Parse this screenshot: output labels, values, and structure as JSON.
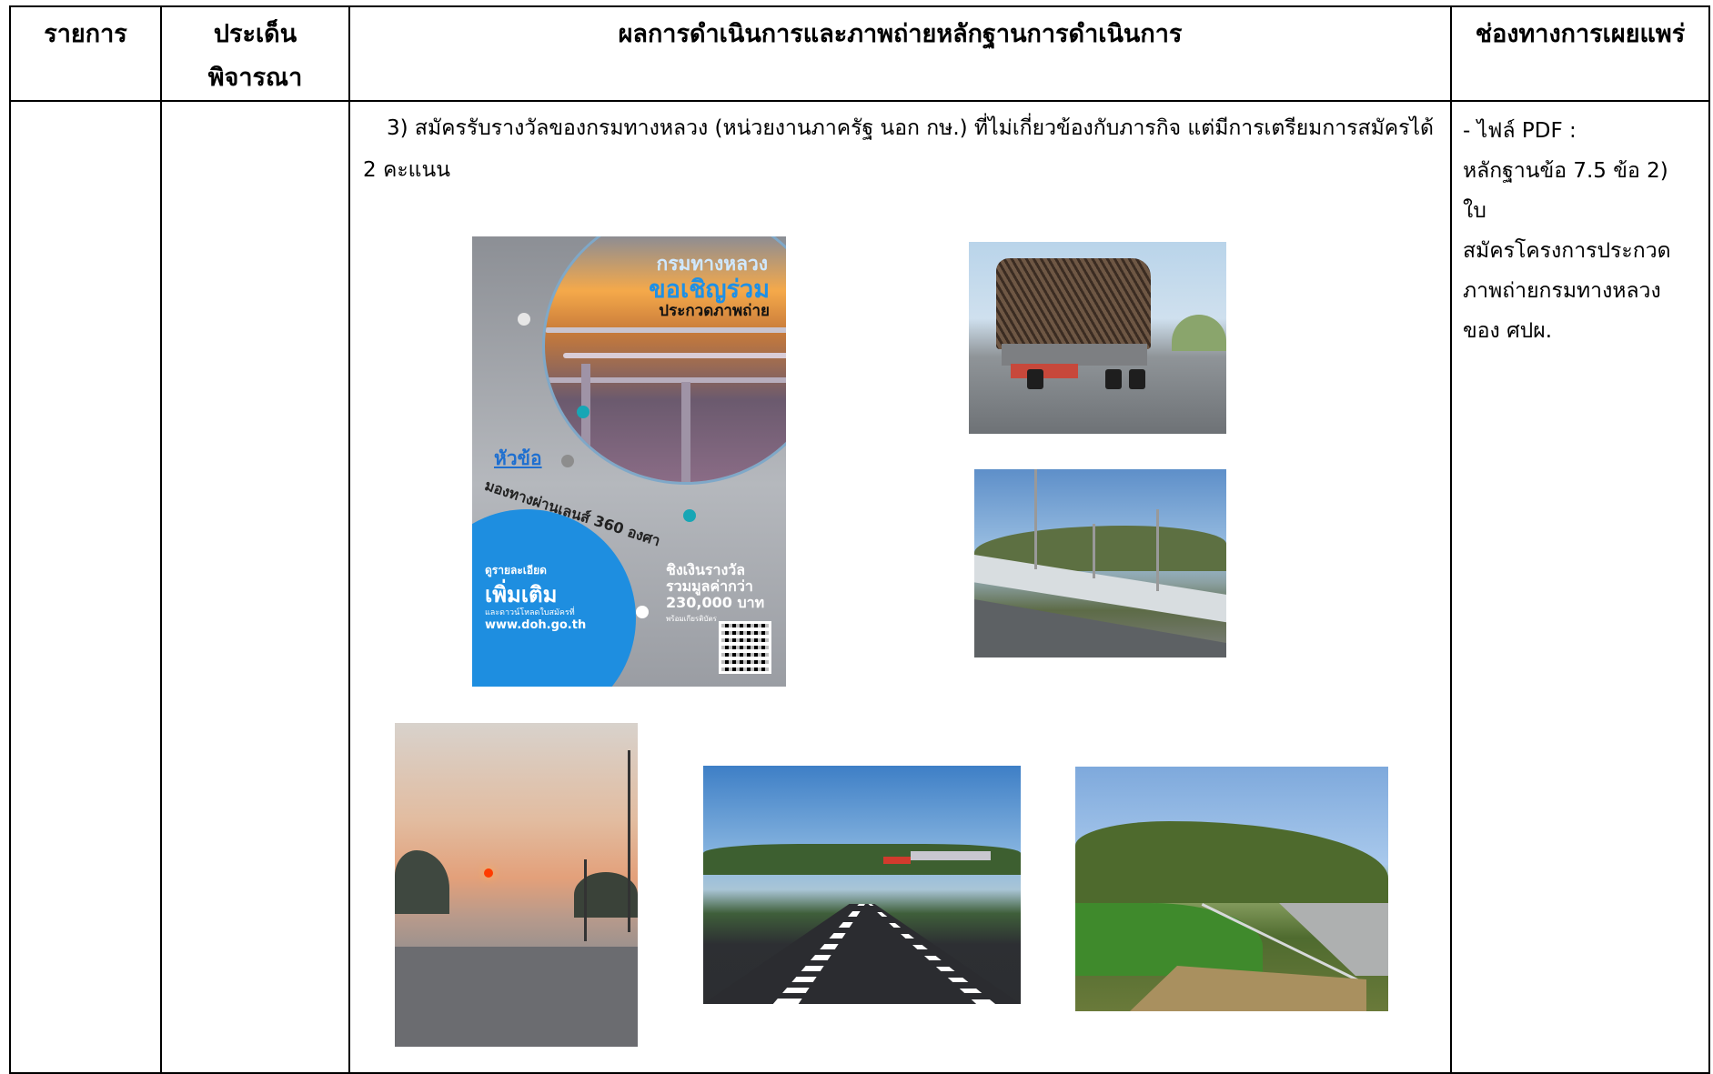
{
  "header": {
    "col1": "รายการ",
    "col2_line1": "ประเด็น",
    "col2_line2": "พิจารณา",
    "col3": "ผลการดำเนินการและภาพถ่ายหลักฐานการดำเนินการ",
    "col4": "ช่องทางการเผยแพร่"
  },
  "body": {
    "para_line1": "3) สมัครรับรางวัลของกรมทางหลวง (หน่วยงานภาครัฐ นอก กษ.) ที่ไม่เกี่ยวข้องกับภารกิจ แต่มีการเตรียมการสมัครได้",
    "para_line2": "2 คะแนน",
    "side_lines": [
      "- ไฟล์ PDF :",
      "หลักฐานข้อ 7.5 ข้อ 2) ใบ",
      "สมัครโครงการประกวด",
      "ภาพถ่ายกรมทางหลวง",
      "ของ ศปผ."
    ]
  },
  "poster": {
    "line1": "กรมทางหลวง",
    "line2": "ขอเชิญร่วม",
    "line3": "ประกวดภาพถ่าย",
    "topic_label": "หัวข้อ",
    "topic": "มองทางผ่านเลนส์ 360 องศา",
    "detail_small": "ดูรายละเอียด",
    "detail_big": "เพิ่มเติม",
    "detail_note": "และดาวน์โหลดใบสมัครที่",
    "url": "www.doh.go.th",
    "prize": "ชิงเงินรางวัล รวมมูลค่ากว่า 230,000 บาท",
    "prize_note": "พร้อมเกียรติบัตร"
  }
}
